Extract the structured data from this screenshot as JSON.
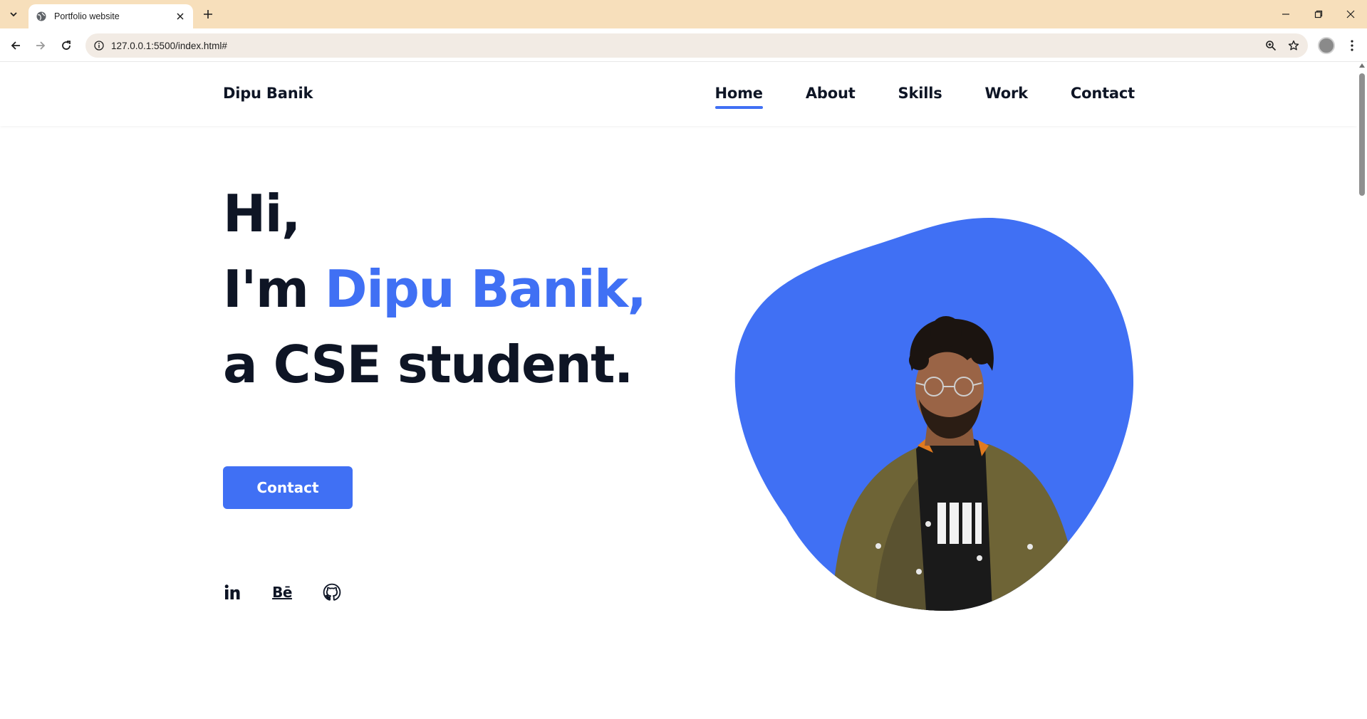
{
  "browser": {
    "tab_title": "Portfolio website",
    "url": "127.0.0.1:5500/index.html#",
    "icons": [
      "tab-list-icon",
      "globe-icon",
      "close-icon",
      "plus-icon",
      "minimize-icon",
      "restore-icon",
      "window-close-icon",
      "back-arrow-icon",
      "forward-arrow-icon",
      "reload-icon",
      "info-icon",
      "zoom-icon",
      "star-icon",
      "profile-avatar",
      "kebab-menu-icon"
    ]
  },
  "site": {
    "logo": "Dipu Banik",
    "nav": [
      {
        "label": "Home",
        "active": true
      },
      {
        "label": "About",
        "active": false
      },
      {
        "label": "Skills",
        "active": false
      },
      {
        "label": "Work",
        "active": false
      },
      {
        "label": "Contact",
        "active": false
      }
    ]
  },
  "hero": {
    "line1": "Hi,",
    "line2_prefix": "I'm ",
    "line2_name": "Dipu Banik,",
    "line3": "a CSE student.",
    "button_label": "Contact",
    "behance_text": "Bē",
    "socials": [
      "linkedin-icon",
      "behance-icon",
      "github-icon"
    ]
  },
  "colors": {
    "accent": "#4070f4",
    "text_dark": "#0e1525",
    "tabbar_bg": "#f7dfbb"
  }
}
